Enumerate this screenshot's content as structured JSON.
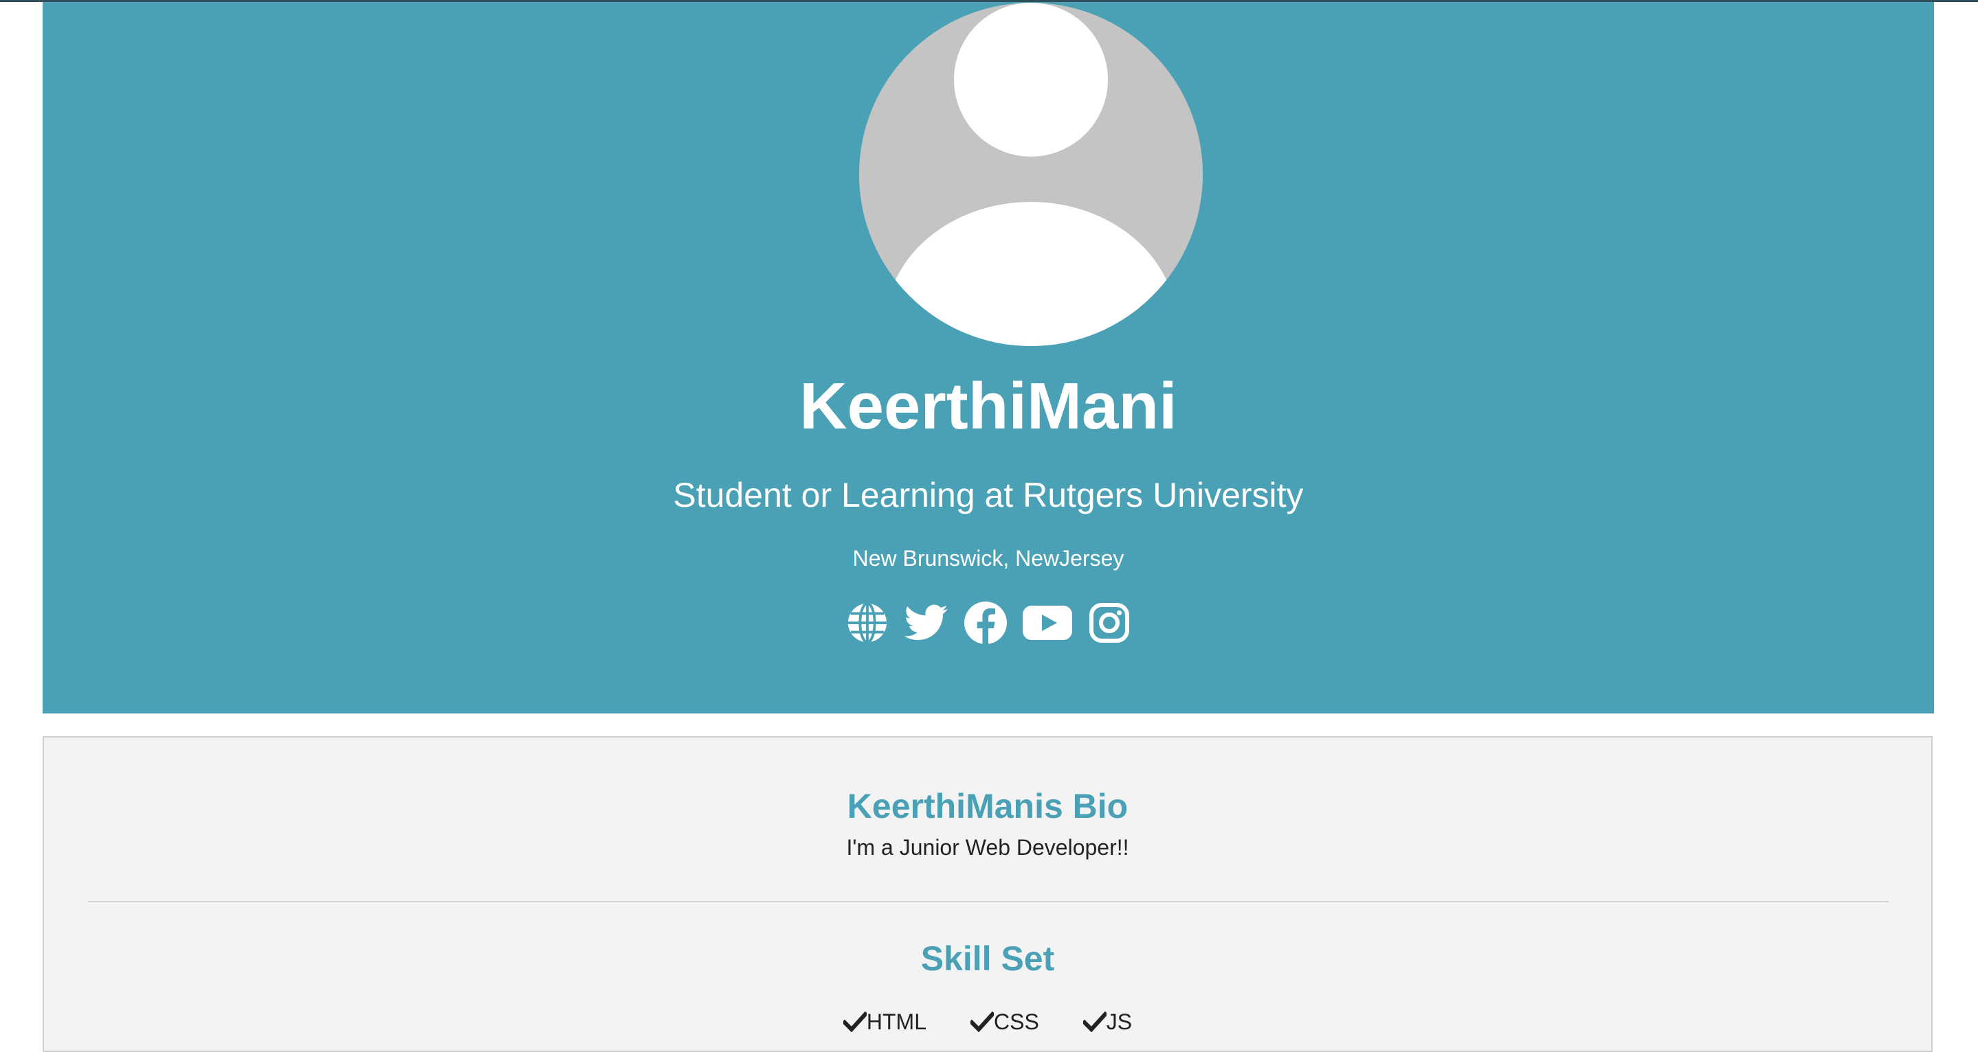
{
  "profile": {
    "name": "KeerthiMani",
    "tagline": "Student or Learning at Rutgers University",
    "location": "New Brunswick, NewJersey"
  },
  "socials": [
    {
      "icon": "globe-icon",
      "label": "Website"
    },
    {
      "icon": "twitter-icon",
      "label": "Twitter"
    },
    {
      "icon": "facebook-icon",
      "label": "Facebook"
    },
    {
      "icon": "youtube-icon",
      "label": "YouTube"
    },
    {
      "icon": "instagram-icon",
      "label": "Instagram"
    }
  ],
  "bio": {
    "title": "KeerthiManis Bio",
    "text": "I'm a Junior Web Developer!!"
  },
  "skills": {
    "title": "Skill Set",
    "items": [
      "HTML",
      "CSS",
      "JS"
    ]
  },
  "colors": {
    "accent": "#4aa0b5",
    "card_bg": "#f3f3f3",
    "avatar_bg": "#c4c4c4"
  }
}
